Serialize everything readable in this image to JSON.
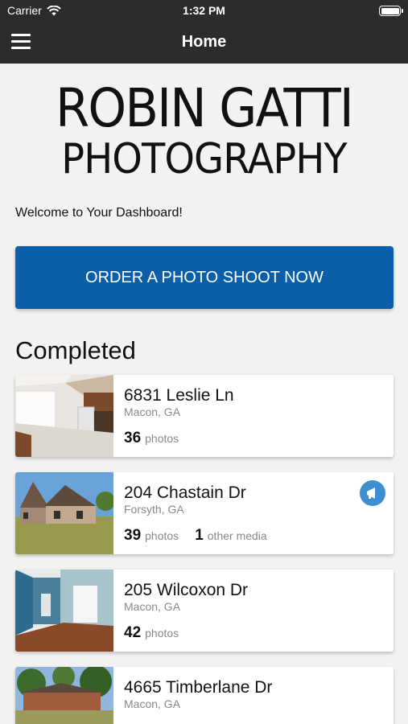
{
  "status": {
    "carrier": "Carrier",
    "time": "1:32 PM"
  },
  "nav": {
    "title": "Home"
  },
  "logo": {
    "line1": "ROBIN GATTI",
    "line2": "PHOTOGRAPHY"
  },
  "welcome": "Welcome to Your Dashboard!",
  "order_button": "ORDER A PHOTO SHOOT NOW",
  "section_title": "Completed",
  "listings": [
    {
      "address": "6831 Leslie Ln",
      "city": "Macon, GA",
      "photos": "36",
      "photos_label": "photos"
    },
    {
      "address": "204 Chastain Dr",
      "city": "Forsyth, GA",
      "photos": "39",
      "photos_label": "photos",
      "other": "1",
      "other_label": "other media"
    },
    {
      "address": "205 Wilcoxon Dr",
      "city": "Macon, GA",
      "photos": "42",
      "photos_label": "photos"
    },
    {
      "address": "4665 Timberlane Dr",
      "city": "Macon, GA"
    }
  ],
  "icons": {
    "menu": "hamburger-menu-icon",
    "wifi": "wifi-icon",
    "battery": "battery-icon",
    "media": "megaphone-icon"
  },
  "colors": {
    "bar": "#2c2c2c",
    "primary": "#0a5fa8",
    "badge": "#3d8fd1",
    "background": "#f2f2f2"
  }
}
